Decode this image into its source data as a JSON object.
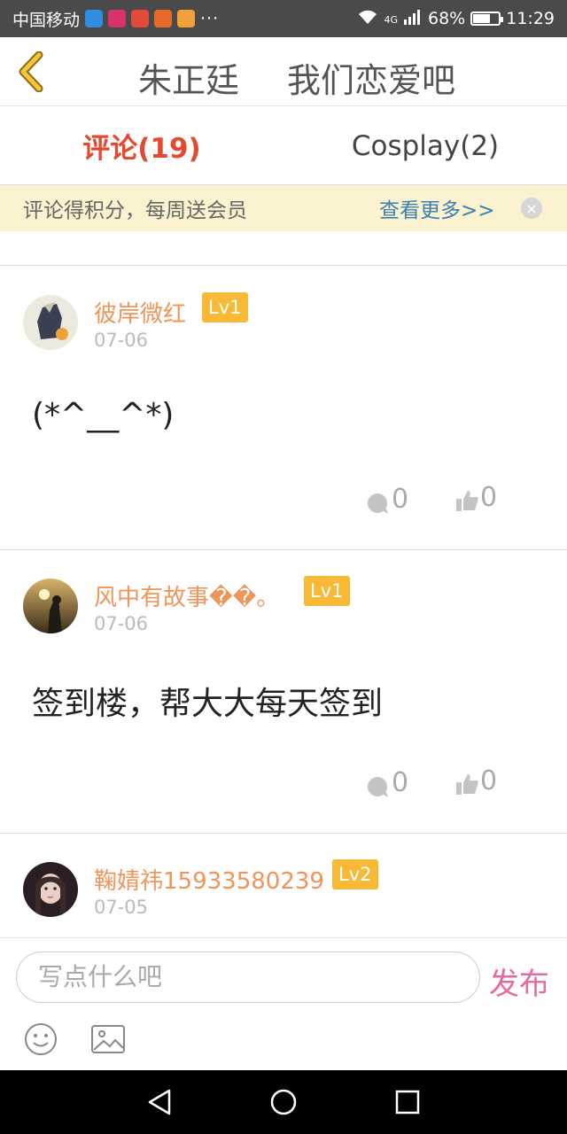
{
  "status_bar": {
    "carrier": "中国移动",
    "dots": "···",
    "network": "4G",
    "battery": "68%",
    "time": "11:29"
  },
  "header": {
    "author": "朱正廷",
    "title": "我们恋爱吧"
  },
  "tabs": [
    {
      "label": "评论(19)",
      "active": true
    },
    {
      "label": "Cosplay(2)",
      "active": false
    }
  ],
  "banner": {
    "text": "评论得积分，每周送会员",
    "more": "查看更多>>",
    "close": "×"
  },
  "comments": [
    {
      "username": "彼岸微红",
      "level": "Lv1",
      "date": "07-06",
      "content": "(*^__^*)",
      "replies": "0",
      "likes": "0"
    },
    {
      "username": "风中有故事��。",
      "level": "Lv1",
      "date": "07-06",
      "content": "签到楼，帮大大每天签到",
      "replies": "0",
      "likes": "0"
    },
    {
      "username": "鞠婧祎15933580239",
      "level": "Lv2",
      "date": "07-05"
    }
  ],
  "compose": {
    "placeholder": "写点什么吧",
    "publish": "发布"
  },
  "colors": {
    "accent_red": "#e34a2f",
    "username_orange": "#f0955a",
    "level_badge": "#f7b936",
    "banner_bg": "#fbf3cf",
    "link_blue": "#3d7fb0",
    "publish_pink": "#e86aa2"
  }
}
